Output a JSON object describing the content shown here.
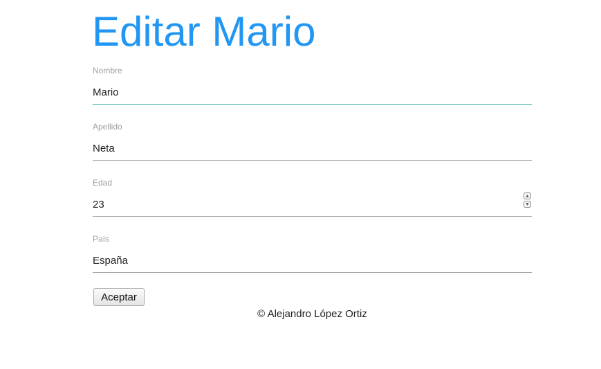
{
  "page": {
    "title": "Editar Mario"
  },
  "form": {
    "nombre": {
      "label": "Nombre",
      "value": "Mario"
    },
    "apellido": {
      "label": "Apellido",
      "value": "Neta"
    },
    "edad": {
      "label": "Edad",
      "value": "23"
    },
    "pais": {
      "label": "País",
      "value": "España"
    },
    "submit_label": "Aceptar"
  },
  "footer": {
    "text": "© Alejandro López Ortiz"
  },
  "icons": {
    "spinner_up": "chevron-up-icon",
    "spinner_down": "chevron-down-icon"
  },
  "colors": {
    "title": "#2196f3",
    "focus_underline": "#26a69a",
    "label": "#9e9e9e",
    "underline": "#9e9e9e"
  }
}
